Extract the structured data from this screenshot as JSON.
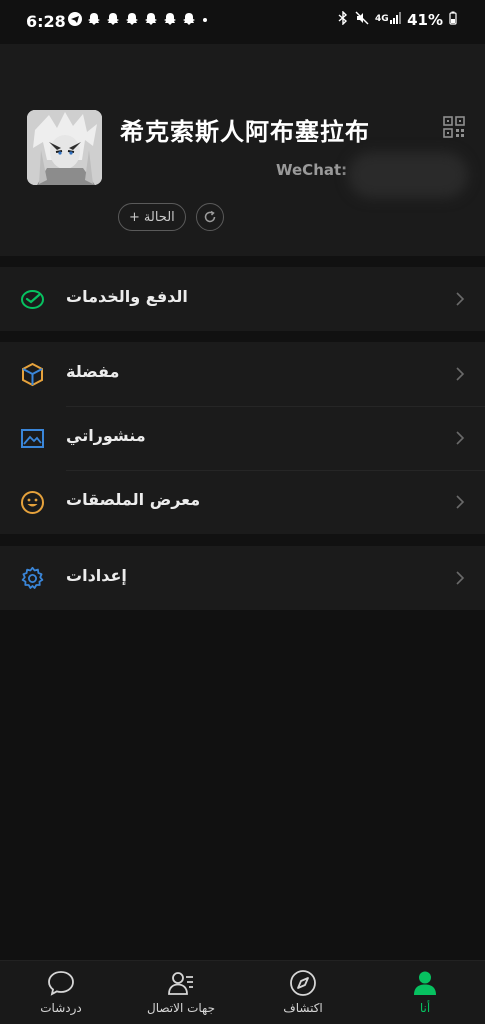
{
  "status_bar": {
    "time": "6:28",
    "notification_icons": [
      "telegram-icon",
      "snapchat-icon",
      "snapchat-icon",
      "snapchat-icon",
      "snapchat-icon",
      "snapchat-icon",
      "snapchat-icon",
      "dot-icon"
    ],
    "battery": "41%"
  },
  "profile": {
    "name": "希克索斯人阿布塞拉布",
    "wechat_id_label": "WeChat: ",
    "status_button_label": "الحالة"
  },
  "menu": {
    "pay": {
      "label": "الدفع والخدمات",
      "icon": "pay-check-icon",
      "color": "#07c160"
    },
    "favorites": {
      "label": "مفضلة",
      "icon": "cube-icon",
      "color": "#e6a23c"
    },
    "posts": {
      "label": "منشوراتي",
      "icon": "image-icon",
      "color": "#3a86d9"
    },
    "stickers": {
      "label": "معرض الملصقات",
      "icon": "smile-icon",
      "color": "#e6a23c"
    },
    "settings": {
      "label": "إعدادات",
      "icon": "gear-icon",
      "color": "#3a86d9"
    }
  },
  "tabbar": {
    "tabs": [
      {
        "label": "دردشات",
        "icon": "chat-bubble-icon"
      },
      {
        "label": "جهات الاتصال",
        "icon": "contacts-icon"
      },
      {
        "label": "اكتشاف",
        "icon": "compass-icon"
      },
      {
        "label": "أنا",
        "icon": "person-icon"
      }
    ],
    "active": "أنا",
    "accent": "#07c160"
  }
}
